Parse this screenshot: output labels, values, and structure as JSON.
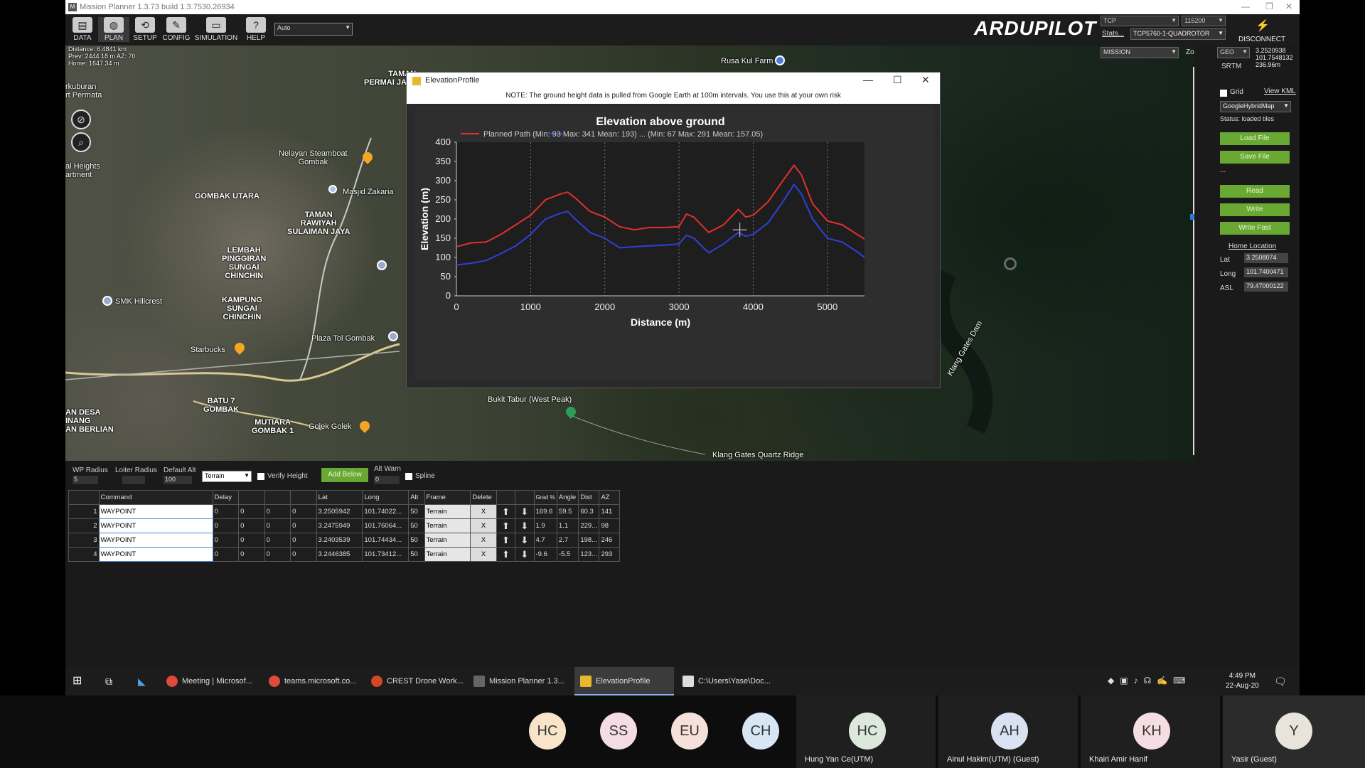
{
  "window": {
    "title": "Mission Planner 1.3.73 build 1.3.7530.26934"
  },
  "toolbar": {
    "items": [
      "DATA",
      "PLAN",
      "SETUP",
      "CONFIG",
      "SIMULATION",
      "HELP"
    ],
    "mode": "Auto",
    "brand": "ARDUPILOT",
    "conn_type": "TCP",
    "baud": "115200",
    "stats": "Stats...",
    "device": "TCP5760-1-QUADROTOR",
    "disconnect": "DISCONNECT"
  },
  "map": {
    "info": {
      "distance": "Distance: 6.4841 km",
      "prev": "Prev: 2444.18 m AZ: 70",
      "home": "Home: 1647.34 m"
    },
    "labels": {
      "kuburan": "rkuburan",
      "permai": "rt Permata",
      "taman_permai": "TAMAN\nPERMAI JAYA",
      "heights": "al Heights\nartment",
      "nelayan": "Nelayan Steamboat\nGombak",
      "masjid": "Masjid Zakaria",
      "gombak_utara": "GOMBAK UTARA",
      "taman_rawiyah": "TAMAN\nRAWIYAH\nSULAIMAN JAYA",
      "lembah": "LEMBAH\nPINGGIRAN\nSUNGAI\nCHINCHIN",
      "smk": "SMK Hillcrest",
      "kampung": "KAMPUNG\nSUNGAI\nCHINCHIN",
      "plaza": "Plaza Tol Gombak",
      "starbucks": "Starbucks",
      "batu": "BATU 7\nGOMBAK",
      "andesa": "AN DESA\nINANG\nAN BERLIAN",
      "mutiara": "MUTIARA\nGOMBAK 1",
      "golek": "Golek Golek",
      "bukit": "Bukit Tabur (West Peak)",
      "klang_dam": "Klang Gates Dam",
      "quartz": "Klang Gates Quartz Ridge",
      "rusa": "Rusa Kul Farm"
    },
    "mission_combo": "MISSION",
    "zoom_label": "Zoom",
    "geo_combo": "GEO",
    "srtm": "SRTM",
    "coords": {
      "lat": "3.2520938",
      "lng": "101.7548132",
      "alt": "236.96m"
    }
  },
  "elevation_profile": {
    "title": "ElevationProfile",
    "note": "NOTE: The ground height data is pulled from Google Earth at 100m intervals. You use this at your own risk",
    "legend": "Planned Path (Min: 93 Max: 341 Mean: 193) ... (Min: 67 Max: 291 Mean: 157.05)"
  },
  "chart_data": {
    "type": "line",
    "title": "Elevation above ground",
    "xlabel": "Distance (m)",
    "ylabel": "Elevation (m)",
    "xlim": [
      0,
      5500
    ],
    "ylim": [
      0,
      400
    ],
    "xticks": [
      0,
      1000,
      2000,
      3000,
      4000,
      5000
    ],
    "yticks": [
      0,
      50,
      100,
      150,
      200,
      250,
      300,
      350,
      400
    ],
    "series": [
      {
        "name": "Planned Path",
        "color": "#e03030",
        "x": [
          0,
          200,
          400,
          600,
          800,
          1000,
          1200,
          1400,
          1500,
          1600,
          1800,
          2000,
          2200,
          2400,
          2600,
          2800,
          3000,
          3100,
          3200,
          3400,
          3600,
          3800,
          3900,
          4000,
          4200,
          4400,
          4550,
          4650,
          4800,
          5000,
          5200,
          5400,
          5500
        ],
        "y": [
          128,
          138,
          140,
          160,
          185,
          210,
          250,
          265,
          270,
          255,
          220,
          205,
          180,
          172,
          178,
          178,
          180,
          213,
          205,
          165,
          185,
          225,
          205,
          210,
          245,
          300,
          340,
          315,
          240,
          195,
          185,
          160,
          148
        ]
      },
      {
        "name": "",
        "color": "#3040d8",
        "x": [
          0,
          200,
          400,
          600,
          800,
          1000,
          1200,
          1400,
          1500,
          1600,
          1800,
          2000,
          2200,
          2400,
          2600,
          2800,
          3000,
          3100,
          3200,
          3400,
          3600,
          3800,
          3900,
          4000,
          4200,
          4400,
          4550,
          4650,
          4800,
          5000,
          5200,
          5400,
          5500
        ],
        "y": [
          80,
          85,
          92,
          110,
          130,
          160,
          200,
          215,
          220,
          200,
          165,
          150,
          125,
          128,
          130,
          132,
          135,
          158,
          150,
          112,
          135,
          165,
          155,
          160,
          190,
          245,
          290,
          265,
          200,
          150,
          140,
          115,
          100
        ]
      }
    ]
  },
  "right_panel": {
    "grid": "Grid",
    "view_kml": "View KML",
    "map_type": "GoogleHybridMap",
    "status": "Status: loaded tiles",
    "load_file": "Load File",
    "save_file": "Save File",
    "dots": "...",
    "read": "Read",
    "write": "Write",
    "write_fast": "Write Fast",
    "home_location": "Home Location",
    "lat_label": "Lat",
    "lat": "3.2508074",
    "long_label": "Long",
    "long": "101.7400471",
    "asl_label": "ASL",
    "asl": "79.47000122"
  },
  "wp_settings": {
    "wp_radius_label": "WP Radius",
    "wp_radius": "5",
    "loiter_radius_label": "Loiter Radius",
    "default_alt_label": "Default Alt",
    "default_alt": "100",
    "frame": "Terrain",
    "verify_height": "Verify Height",
    "add_below": "Add Below",
    "alt_warn_label": "Alt Warn",
    "alt_warn": "0",
    "spline": "Spline"
  },
  "wp_table": {
    "headers": [
      "",
      "Command",
      "Delay",
      "",
      "",
      "",
      "Lat",
      "Long",
      "Alt",
      "Frame",
      "Delete",
      "",
      "",
      "Grad %",
      "Angle",
      "Dist",
      "AZ"
    ],
    "rows": [
      {
        "n": "1",
        "cmd": "WAYPOINT",
        "d": "0",
        "p2": "0",
        "p3": "0",
        "p4": "0",
        "lat": "3.2505942",
        "lng": "101.74022...",
        "alt": "50",
        "frame": "Terrain",
        "del": "X",
        "grad": "169.6",
        "angle": "59.5",
        "dist": "60.3",
        "az": "141"
      },
      {
        "n": "2",
        "cmd": "WAYPOINT",
        "d": "0",
        "p2": "0",
        "p3": "0",
        "p4": "0",
        "lat": "3.2475949",
        "lng": "101.76064...",
        "alt": "50",
        "frame": "Terrain",
        "del": "X",
        "grad": "1.9",
        "angle": "1.1",
        "dist": "229...",
        "az": "98"
      },
      {
        "n": "3",
        "cmd": "WAYPOINT",
        "d": "0",
        "p2": "0",
        "p3": "0",
        "p4": "0",
        "lat": "3.2403539",
        "lng": "101.74434...",
        "alt": "50",
        "frame": "Terrain",
        "del": "X",
        "grad": "4.7",
        "angle": "2.7",
        "dist": "198...",
        "az": "246"
      },
      {
        "n": "4",
        "cmd": "WAYPOINT",
        "d": "0",
        "p2": "0",
        "p3": "0",
        "p4": "0",
        "lat": "3.2446385",
        "lng": "101.73412...",
        "alt": "50",
        "frame": "Terrain",
        "del": "X",
        "grad": "-9.6",
        "angle": "-5.5",
        "dist": "123...",
        "az": "293"
      }
    ]
  },
  "taskbar": {
    "items": [
      "Meeting | Microsof...",
      "teams.microsoft.co...",
      "CREST Drone Work...",
      "Mission Planner 1.3...",
      "ElevationProfile",
      "C:\\Users\\Yase\\Doc..."
    ],
    "time": "4:49 PM",
    "date": "22-Aug-20"
  },
  "teams": {
    "small": [
      {
        "initials": "HC",
        "color": "#f8e4c8"
      },
      {
        "initials": "SS",
        "color": "#f4dce4"
      },
      {
        "initials": "EU",
        "color": "#f6e0da"
      },
      {
        "initials": "CH",
        "color": "#d6e6f4"
      }
    ],
    "tiles": [
      {
        "initials": "HC",
        "name": "Hung Yan Ce(UTM)",
        "color": "#dde8dc"
      },
      {
        "initials": "AH",
        "name": "Ainul Hakim(UTM) (Guest)",
        "color": "#d8e2f2"
      },
      {
        "initials": "KH",
        "name": "Khairi Amir Hanif",
        "color": "#f6dde4"
      },
      {
        "initials": "Y",
        "name": "Yasir (Guest)",
        "color": "#e8e4dc"
      }
    ]
  }
}
